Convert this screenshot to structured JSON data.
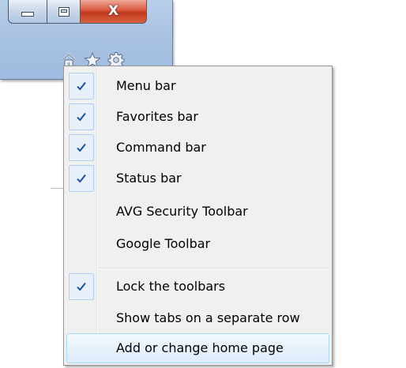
{
  "window": {
    "captions": {
      "minimize": "minimize-icon",
      "maximize": "maximize-icon",
      "close": "close-icon",
      "close_glyph": "X"
    },
    "toolbar_icons": [
      "home-icon",
      "favorites-star-icon",
      "tools-gear-icon"
    ]
  },
  "menu": {
    "items": [
      {
        "label": "Menu bar",
        "checked": true
      },
      {
        "label": "Favorites bar",
        "checked": true
      },
      {
        "label": "Command bar",
        "checked": true
      },
      {
        "label": "Status bar",
        "checked": true
      },
      {
        "label": "AVG Security Toolbar",
        "checked": false
      },
      {
        "label": "Google Toolbar",
        "checked": false
      },
      {
        "label": "Lock the toolbars",
        "checked": true
      },
      {
        "label": "Show tabs on a separate row",
        "checked": false
      },
      {
        "label": "Add or change home page",
        "checked": false,
        "highlighted": true
      }
    ],
    "check_glyph": "✓",
    "accent_color": "#1a4fa3",
    "highlight_color": "#dcebfc"
  }
}
